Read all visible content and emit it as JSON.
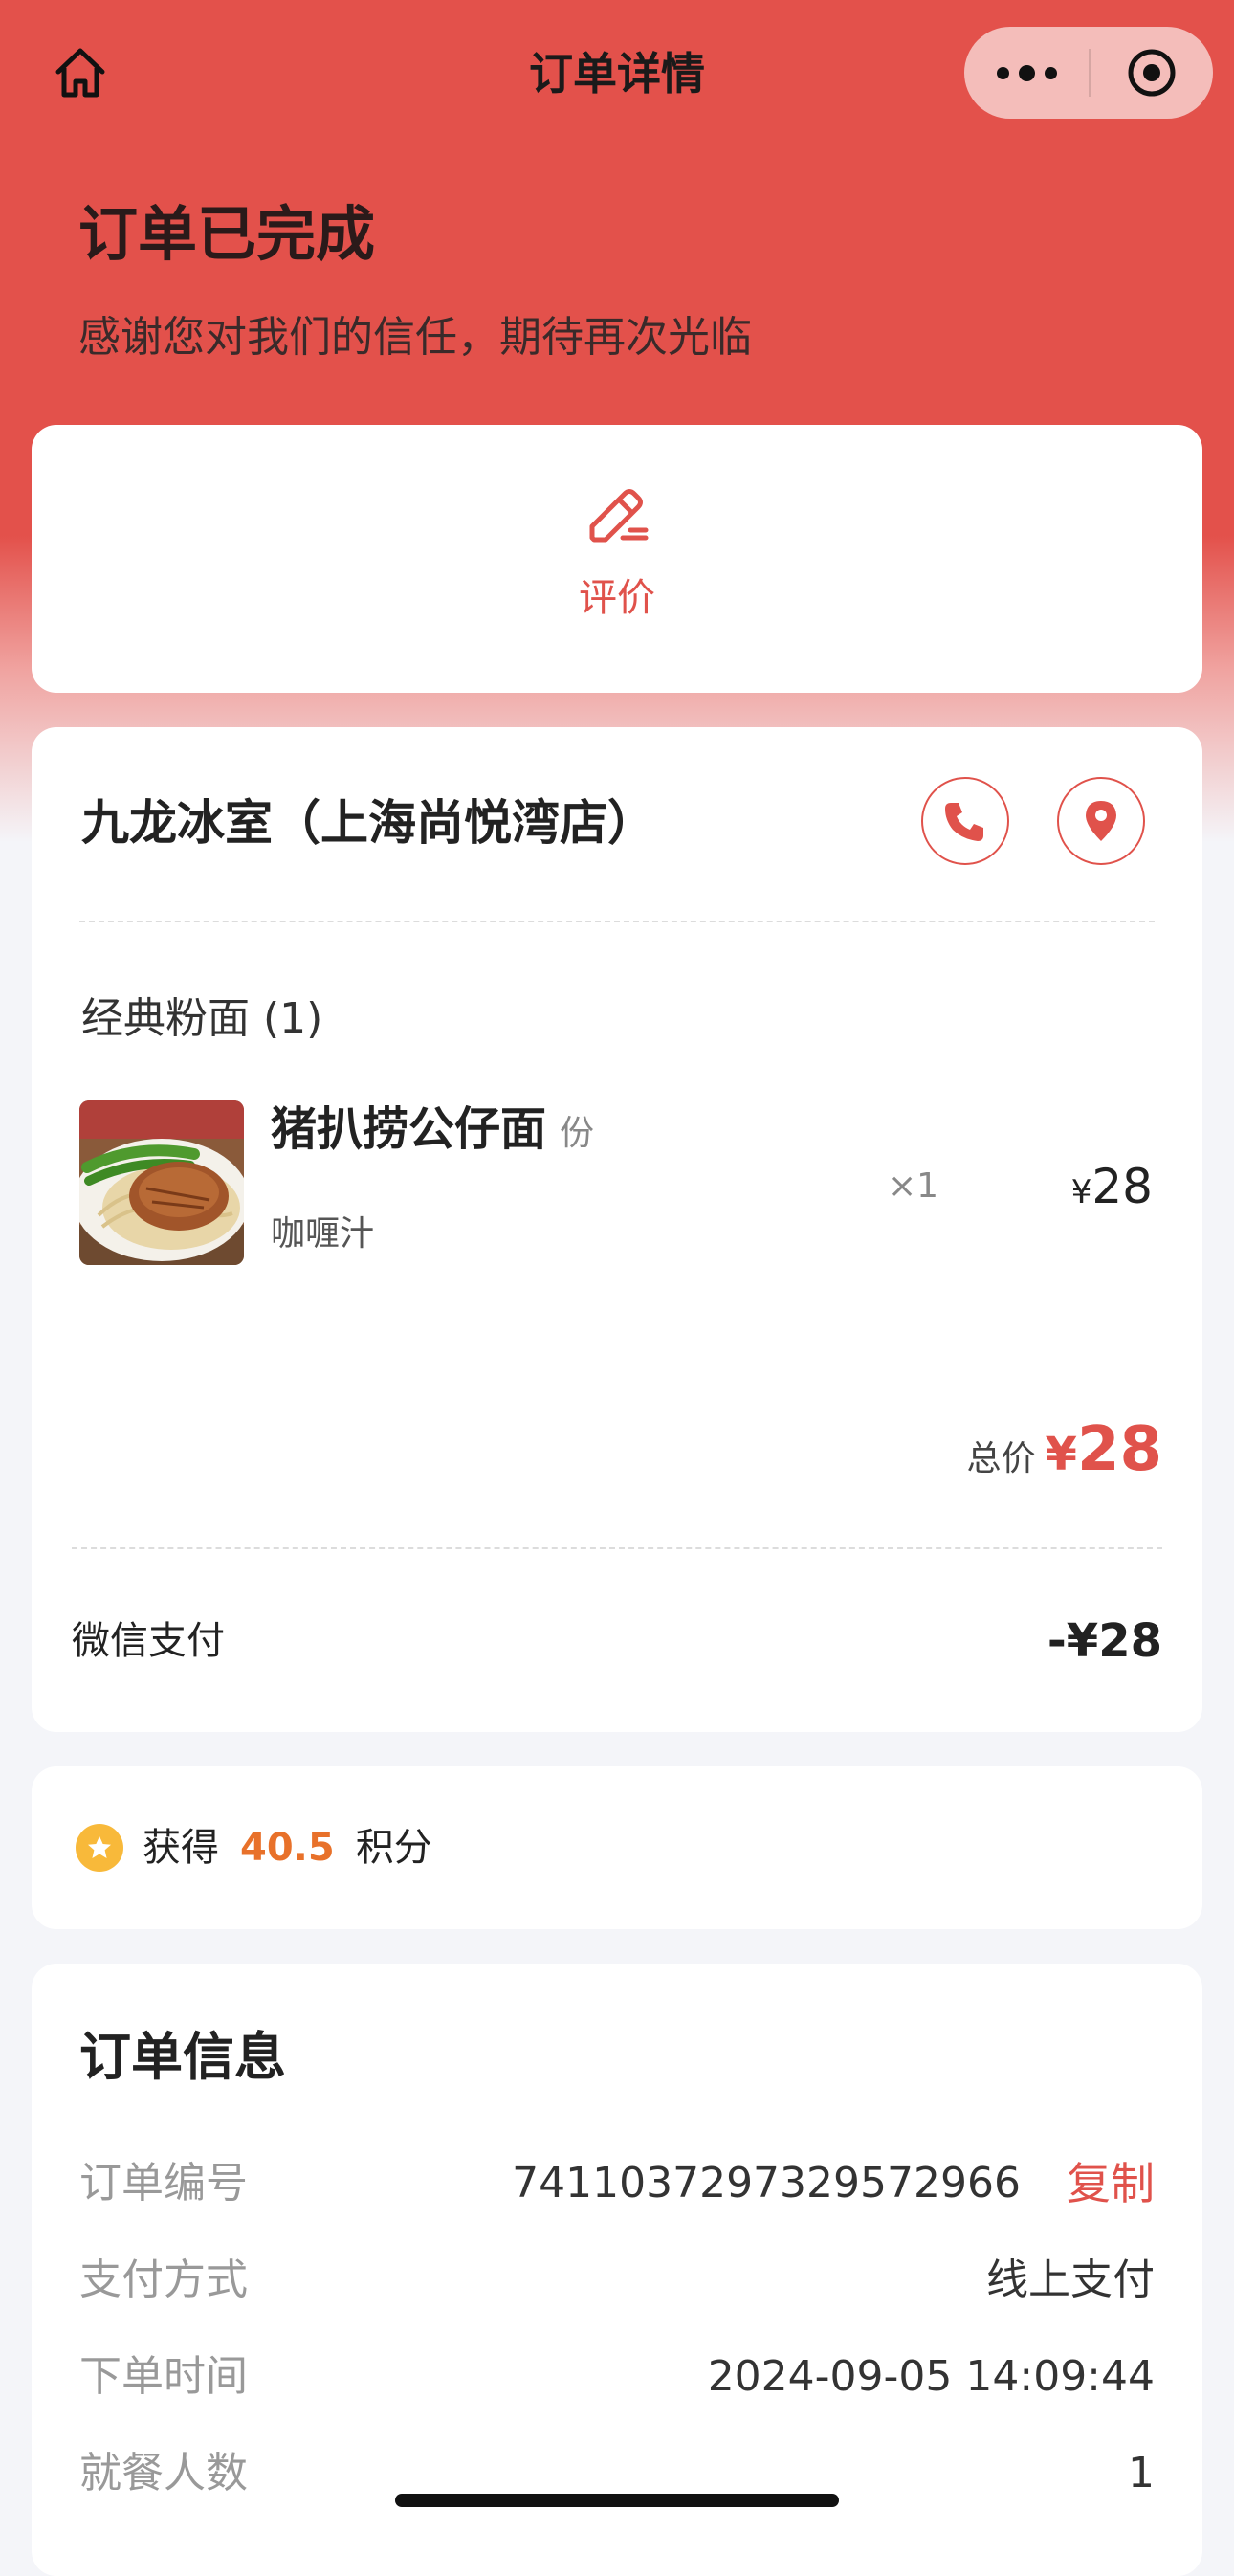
{
  "nav": {
    "title": "订单详情"
  },
  "status": {
    "title": "订单已完成",
    "subtitle": "感谢您对我们的信任，期待再次光临"
  },
  "actions": {
    "review_label": "评价"
  },
  "store": {
    "name": "九龙冰室（上海尚悦湾店）"
  },
  "order": {
    "category": "经典粉面 (1)",
    "items": [
      {
        "name": "猪扒捞公仔面",
        "unit": "份",
        "spec": "咖喱汁",
        "qty": "×1",
        "currency": "¥",
        "price": "28"
      }
    ],
    "total_label": "总价",
    "total_currency": "¥",
    "total_value": "28",
    "payment_label": "微信支付",
    "payment_amount": "-¥28"
  },
  "points": {
    "prefix": "获得",
    "value": "40.5",
    "suffix": "积分"
  },
  "info": {
    "title": "订单信息",
    "copy_label": "复制",
    "rows": [
      {
        "label": "订单编号",
        "value": "7411037297329572966"
      },
      {
        "label": "支付方式",
        "value": "线上支付"
      },
      {
        "label": "下单时间",
        "value": "2024-09-05 14:09:44"
      },
      {
        "label": "就餐人数",
        "value": "1"
      }
    ]
  },
  "colors": {
    "brand_red": "#e3514b",
    "accent_red": "#e0524b",
    "points_orange": "#e8712a",
    "star_yellow": "#f8b93a"
  },
  "icons": {
    "nav_home": "home-icon",
    "more": "more-dots-icon",
    "mini_close": "target-icon",
    "review": "pencil-icon",
    "call": "phone-icon",
    "location": "location-pin-icon",
    "points": "star-icon"
  }
}
